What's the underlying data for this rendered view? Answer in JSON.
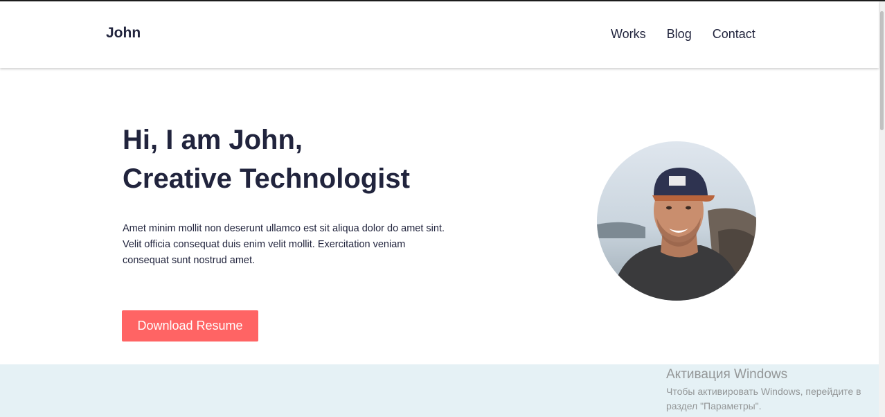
{
  "header": {
    "logo": "John",
    "nav": [
      {
        "label": "Works"
      },
      {
        "label": "Blog"
      },
      {
        "label": "Contact"
      }
    ]
  },
  "hero": {
    "title_line1": "Hi, I am John,",
    "title_line2": "Creative Technologist",
    "description": "Amet minim mollit non deserunt ullamco est sit aliqua dolor do amet sint. Velit officia consequat duis enim velit mollit. Exercitation veniam consequat sunt nostrud amet.",
    "button_label": "Download Resume",
    "avatar_icon": "profile-photo"
  },
  "watermark": {
    "title": "Активация Windows",
    "line1": "Чтобы активировать Windows, перейдите в",
    "line2": "раздел \"Параметры\"."
  },
  "colors": {
    "text": "#21243d",
    "accent": "#ff6464",
    "band": "#e5f1f5"
  }
}
